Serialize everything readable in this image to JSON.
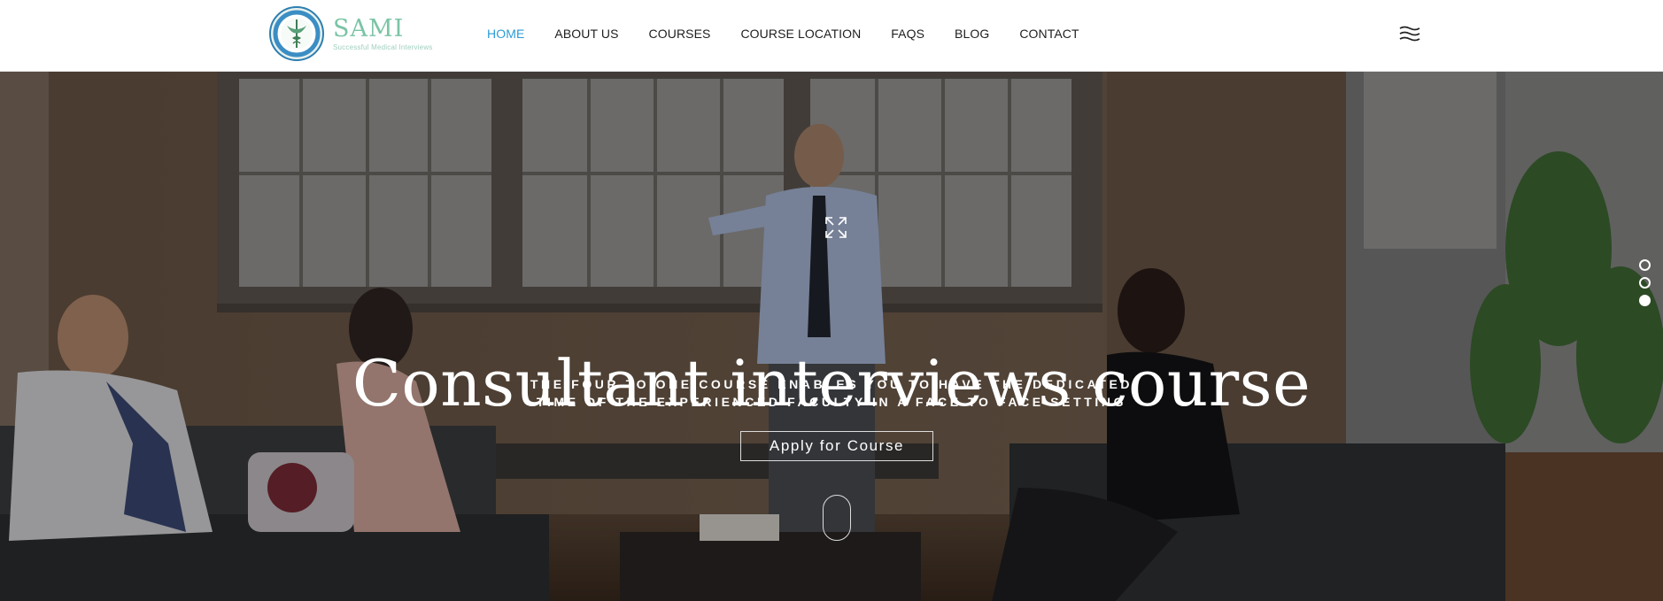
{
  "brand": {
    "title": "SAMI",
    "subtitle": "Successful Medical Interviews"
  },
  "nav": {
    "items": [
      {
        "label": "HOME",
        "active": true
      },
      {
        "label": "ABOUT US",
        "active": false
      },
      {
        "label": "COURSES",
        "active": false
      },
      {
        "label": "COURSE LOCATION",
        "active": false
      },
      {
        "label": "FAQS",
        "active": false
      },
      {
        "label": "BLOG",
        "active": false
      },
      {
        "label": "CONTACT",
        "active": false
      }
    ],
    "menu_icon": "menu-waves-icon"
  },
  "hero": {
    "title": "Consultant interviews course",
    "subtitle_line1": "THE FOUR TO ONE COURSE ENABLES YOU TO HAVE THE DEDICATED",
    "subtitle_line2": "TIME OF THE EXPERIENCED FACULTY IN A FACE TO FACE SETTING",
    "cta_label": "Apply for Course",
    "expand_icon": "expand-arrows-icon",
    "scroll_icon": "scroll-mouse-icon",
    "slider_dots": 3,
    "active_dot": 3
  },
  "colors": {
    "accent": "#2d9bd6",
    "brand": "#7bc4a6",
    "nav_text": "#1e1e1e"
  }
}
